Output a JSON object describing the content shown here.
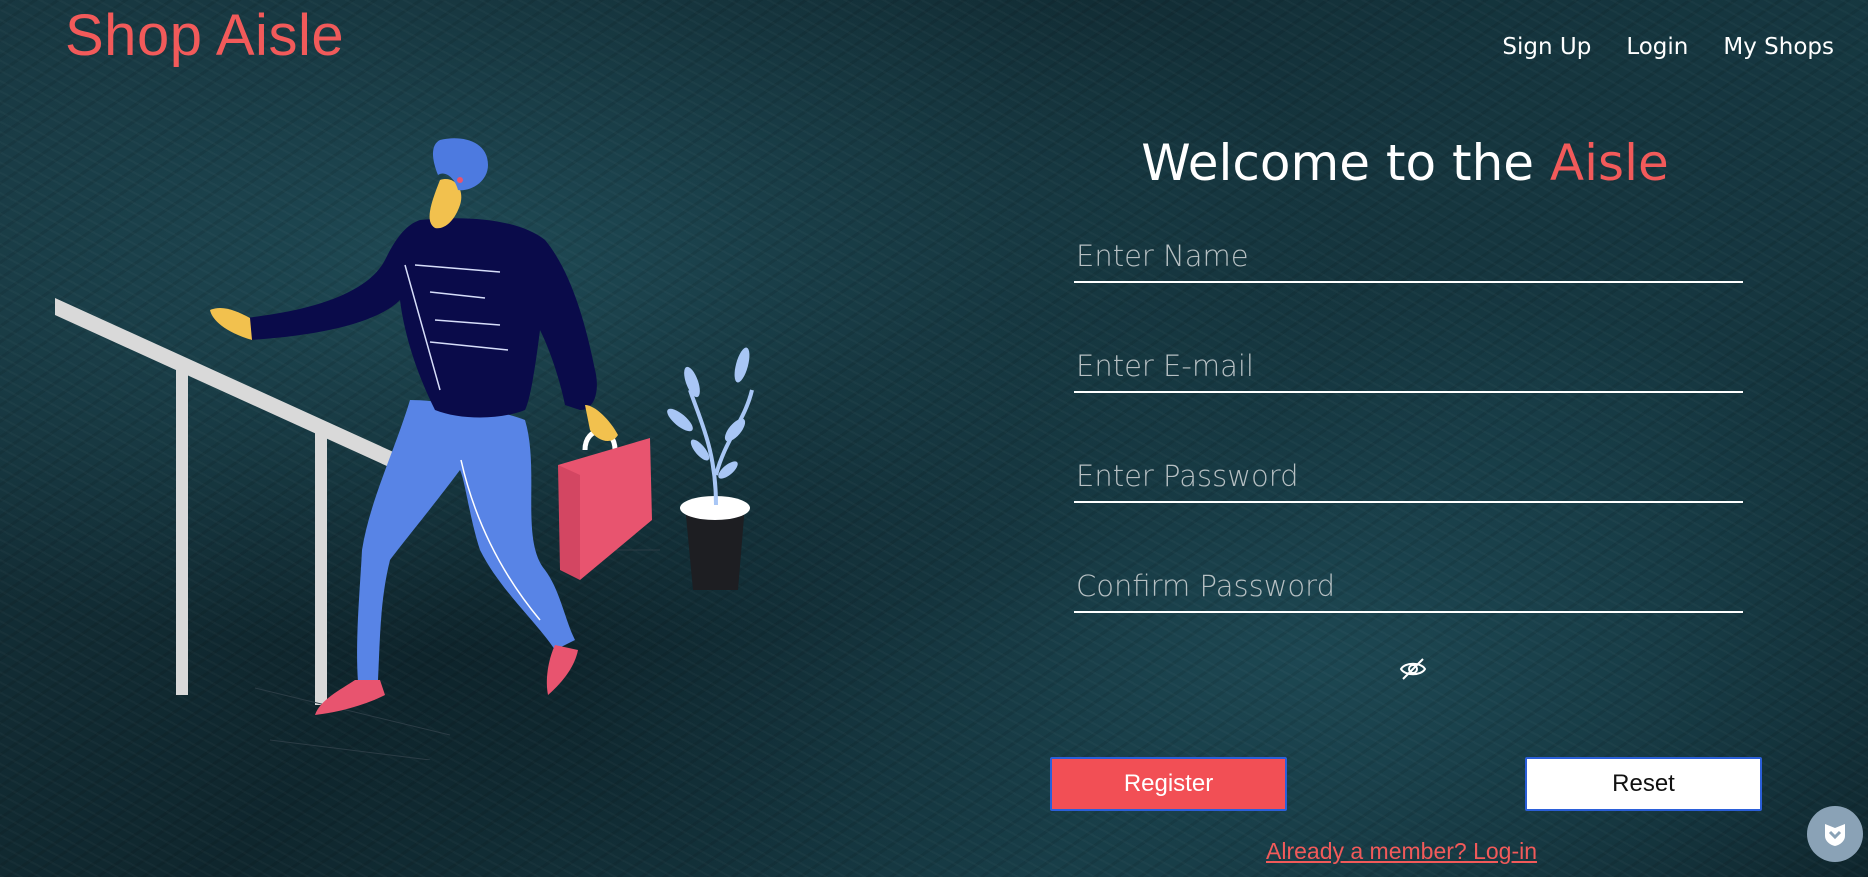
{
  "brand": {
    "title": "Shop Aisle",
    "color": "#f25a5a"
  },
  "nav": {
    "items": [
      "Sign Up",
      "Login",
      "My Shops"
    ]
  },
  "heading": {
    "prefix": "Welcome to the ",
    "accent": "Aisle"
  },
  "form": {
    "name_placeholder": "Enter Name",
    "email_placeholder": "Enter E-mail",
    "password_placeholder": "Enter Password",
    "confirm_placeholder": "Confirm Password",
    "toggle_icon": "eye-slash-icon",
    "register_label": "Register",
    "reset_label": "Reset",
    "login_link": "Already a member? Log-in"
  },
  "colors": {
    "accent": "#f25a5a",
    "button_border": "#2b5fd9"
  },
  "floating": {
    "icon": "shield-icon"
  }
}
